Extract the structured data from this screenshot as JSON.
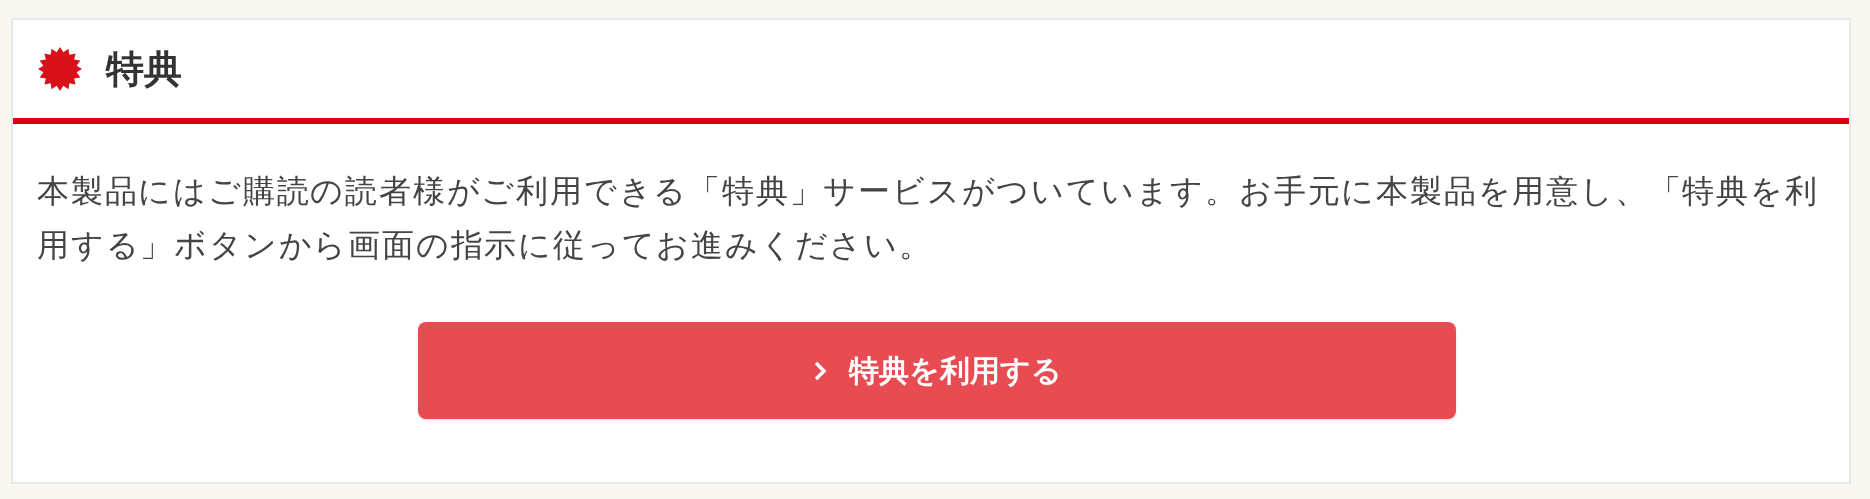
{
  "section": {
    "title": "特典"
  },
  "description": "本製品にはご購読の読者様がご利用できる「特典」サービスがついています。お手元に本製品を用意し、「特典を利用する」ボタンから画面の指示に従ってお進みください。",
  "button": {
    "label": "特典を利用する"
  }
}
